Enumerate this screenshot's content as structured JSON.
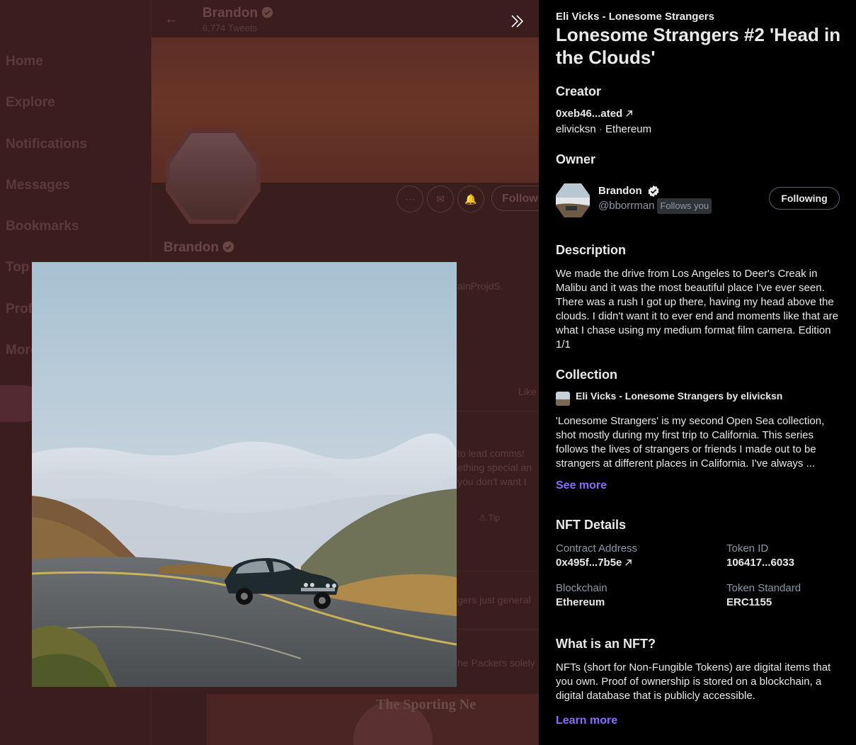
{
  "background": {
    "header": {
      "name": "Brandon",
      "subtitle": "6,774 Tweets"
    },
    "nav": [
      "Home",
      "Explore",
      "Notifications",
      "Messages",
      "Bookmarks",
      "Top",
      "Prof",
      "More"
    ],
    "profile_name": "Brandon",
    "follow_label": "Followi",
    "fragments": {
      "bio": "ainProjdS.",
      "tab_likes": "Like",
      "tweet1_line1": "to lead comms!",
      "tweet1_line2": "ething special an",
      "tweet1_line3": "you don't want t",
      "tweet1_tip": "Tip",
      "tweet2": "gers just general",
      "tweet3": "he Packers solely",
      "sporting_news": "The Sporting Ne"
    }
  },
  "panel": {
    "collection_line": "Eli Vicks - Lonesome Strangers",
    "title": "Lonesome Strangers #2 'Head in the Clouds'",
    "creator": {
      "heading": "Creator",
      "address": "0xeb46...ated",
      "handle": "elivicksn",
      "chain": "Ethereum",
      "separator": "·"
    },
    "owner": {
      "heading": "Owner",
      "name": "Brandon",
      "handle": "@bborrman",
      "follows_you": "Follows you",
      "button": "Following"
    },
    "description": {
      "heading": "Description",
      "text": "We made the drive from Los Angeles to Deer's Creak in Malibu and it was the most beautiful place I've ever seen. There was a rush I got up there, having my head above the clouds. I didn't want it to ever end and moments like that are what I chase using my medium format film camera. Edition 1/1"
    },
    "collection": {
      "heading": "Collection",
      "name": "Eli Vicks - Lonesome Strangers by elivicksn",
      "text": "'Lonesome Strangers' is my second Open Sea collection, shot mostly during my first trip to California. This series follows the lives of strangers or friends I made out to be strangers at different places in California. I've always ...",
      "see_more": "See more"
    },
    "nft_details": {
      "heading": "NFT Details",
      "contract_label": "Contract Address",
      "contract_value": "0x495f...7b5e",
      "token_id_label": "Token ID",
      "token_id_value": "106417...6033",
      "blockchain_label": "Blockchain",
      "blockchain_value": "Ethereum",
      "standard_label": "Token Standard",
      "standard_value": "ERC1155"
    },
    "what_is": {
      "heading": "What is an NFT?",
      "text": "NFTs (short for Non-Fungible Tokens) are digital items that you own. Proof of ownership is stored on a blockchain, a digital database that is publicly accessible.",
      "learn_more": "Learn more"
    }
  },
  "colors": {
    "accent": "#8b6cff",
    "panel_bg": "#000000",
    "overlay": "#3a1c1c",
    "verified": "#e7e9ea"
  }
}
